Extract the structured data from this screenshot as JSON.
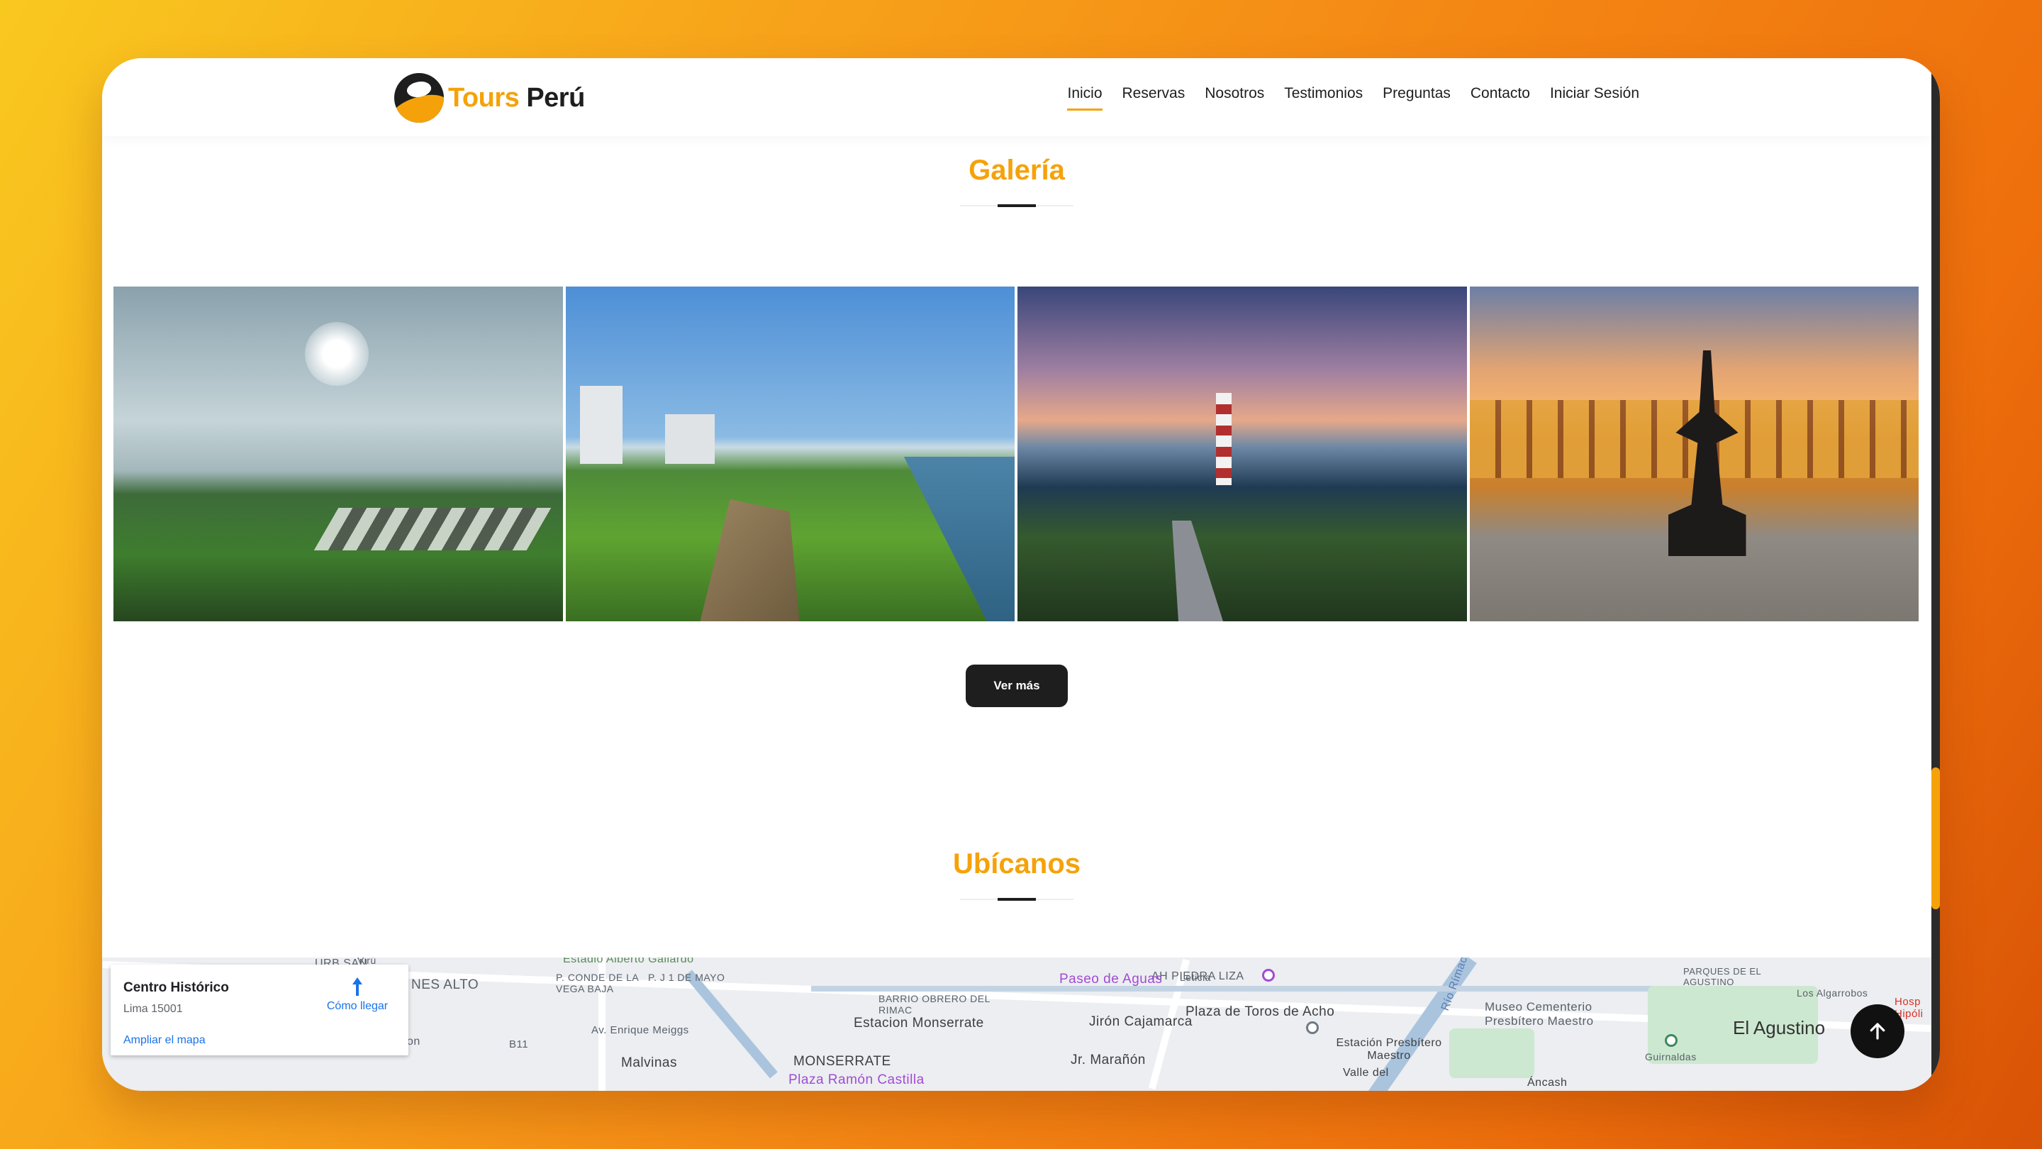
{
  "brand": {
    "name_part1": "Tours",
    "name_part2": "Perú"
  },
  "nav": {
    "items": [
      {
        "label": "Inicio",
        "active": true
      },
      {
        "label": "Reservas"
      },
      {
        "label": "Nosotros"
      },
      {
        "label": "Testimonios"
      },
      {
        "label": "Preguntas"
      },
      {
        "label": "Contacto"
      },
      {
        "label": "Iniciar Sesión"
      }
    ]
  },
  "gallery": {
    "title": "Galería",
    "more_button": "Ver más"
  },
  "location": {
    "title": "Ubícanos"
  },
  "map_card": {
    "place": "Centro Histórico",
    "address": "Lima 15001",
    "directions": "Cómo llegar",
    "enlarge": "Ampliar el mapa"
  },
  "map_labels": {
    "urb_san": "URB SAN",
    "nes_alto": "NES ALTO",
    "estadio": "Estadio Alberto Gallardo",
    "pconde": "P. CONDE DE LA VEGA BAJA",
    "pj": "P. J 1 DE MAYO",
    "barrio": "BARRIO OBRERO DEL RIMAC",
    "estacion_monserrate": "Estacion Monserrate",
    "paseo": "Paseo de Aguas",
    "jiron_cajamarca": "Jirón Cajamarca",
    "plaza_toros": "Plaza de Toros de Acho",
    "ah_piedra": "AH PIEDRA LIZA",
    "rio_rimac": "Río Rímac",
    "museo": "Museo Cementerio Presbítero Maestro",
    "parques": "PARQUES DE EL AGUSTINO",
    "el_agustino": "El Agustino",
    "av_enrique": "Av. Enrique Meiggs",
    "malvinas": "Malvinas",
    "monserrate": "MONSERRATE",
    "plaza_ramon": "Plaza Ramón Castilla",
    "jr_maranon": "Jr. Marañón",
    "estacion_pm": "Estación Presbítero Maestro",
    "valle": "Valle del",
    "ancash": "Áncash",
    "leticia": "Leticia",
    "b11": "B11",
    "on": "on",
    "viru": "Virú",
    "los_algarrobos": "Los Algarrobos",
    "guirnaldas": "Guirnaldas",
    "hospital": "Hosp Hipóli"
  },
  "colors": {
    "accent": "#f5a20a",
    "dark": "#1e1e1e",
    "link": "#1a73e8"
  },
  "icons": {
    "back_to_top": "arrow-up-icon",
    "directions": "directions-icon"
  }
}
